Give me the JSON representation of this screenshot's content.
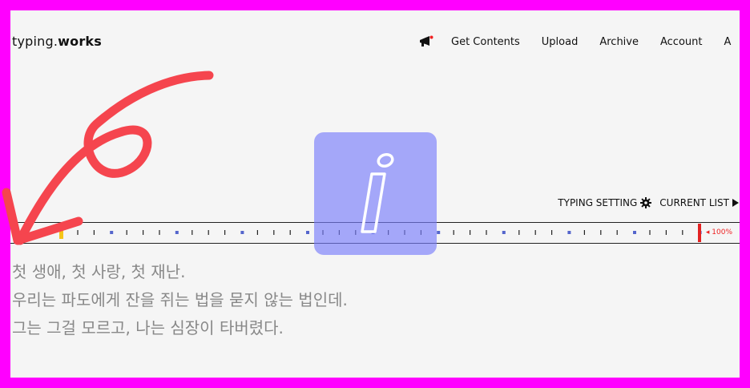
{
  "brand": {
    "prefix": "typing.",
    "suffix": "works"
  },
  "nav": {
    "items": [
      "Get Contents",
      "Upload",
      "Archive",
      "Account",
      "A"
    ]
  },
  "settings": {
    "typing_setting": "TYPING SETTING",
    "current_list": "CURRENT LIST"
  },
  "progress": {
    "label": "100%",
    "value": 1.0
  },
  "text": {
    "lines": [
      "첫 생애, 첫 사랑, 첫 재난.",
      "우리는 파도에게 잔을 쥐는 법을 묻지 않는 법인데.",
      "그는 그걸 모르고, 나는 심장이 타버렸다."
    ]
  },
  "colors": {
    "frame_border": "#ff00ff",
    "background": "#f5f5f5",
    "progress_marker": "#e22222",
    "cursor_marker": "#f5c518",
    "tick_accent": "#5566cc",
    "annotation_arrow": "#f5454e",
    "info_badge": "#787dfa"
  },
  "icons": {
    "notice": "megaphone-icon",
    "settings": "gear-icon",
    "list": "play-triangle-icon",
    "overlay": "info-icon"
  }
}
